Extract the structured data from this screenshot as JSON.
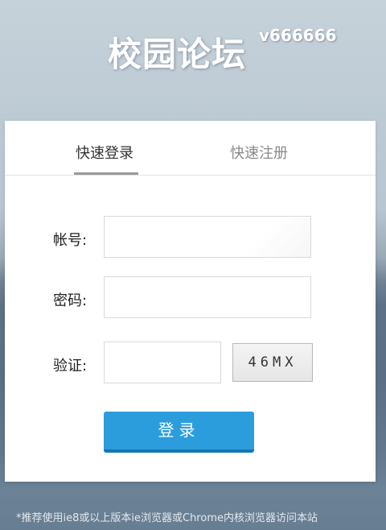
{
  "header": {
    "site_title": "校园论坛",
    "version": "v666666"
  },
  "tabs": [
    {
      "label": "快速登录",
      "active": true
    },
    {
      "label": "快速注册",
      "active": false
    }
  ],
  "form": {
    "account_label": "帐号:",
    "account_value": "",
    "password_label": "密码:",
    "password_value": "",
    "captcha_label": "验证:",
    "captcha_value": "",
    "captcha_code": "46MX",
    "submit_label": "登录"
  },
  "footer": {
    "note": "*推荐使用ie8或以上版本ie浏览器或Chrome内核浏览器访问本站"
  },
  "colors": {
    "accent": "#2b9ddd",
    "accent_dark": "#1477b3",
    "tab_active_text": "#333333",
    "tab_inactive_text": "#8a8a8a"
  }
}
